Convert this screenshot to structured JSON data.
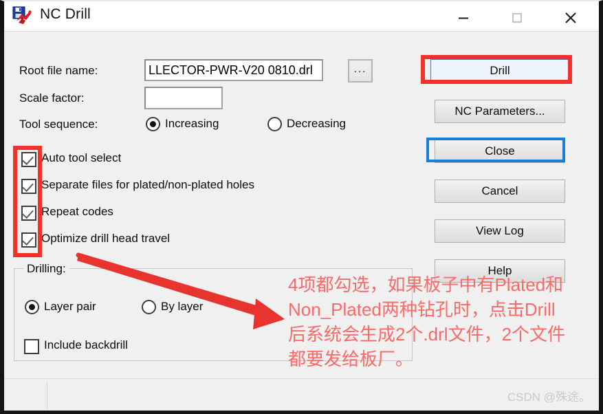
{
  "window": {
    "title": "NC Drill",
    "icon": "nc-drill-app-icon",
    "controls": {
      "minimize": "—",
      "maximize": "□",
      "close": "✕"
    }
  },
  "form": {
    "root_file_label": "Root file name:",
    "root_file_value": "LLECTOR-PWR-V20 0810.drl",
    "browse_label": "...",
    "scale_factor_label": "Scale factor:",
    "scale_factor_value": "",
    "tool_sequence_label": "Tool sequence:",
    "tool_sequence_options": [
      {
        "label": "Increasing",
        "selected": true
      },
      {
        "label": "Decreasing",
        "selected": false
      }
    ]
  },
  "options": [
    {
      "label": "Auto tool select",
      "checked": true
    },
    {
      "label": "Separate files for plated/non-plated holes",
      "checked": true
    },
    {
      "label": "Repeat codes",
      "checked": true
    },
    {
      "label": "Optimize drill head travel",
      "checked": true
    }
  ],
  "drilling": {
    "group_title": "Drilling:",
    "mode_options": [
      {
        "label": "Layer pair",
        "selected": true
      },
      {
        "label": "By layer",
        "selected": false
      }
    ],
    "include_backdrill": {
      "label": "Include backdrill",
      "checked": false
    }
  },
  "buttons": [
    {
      "label": "Drill",
      "style": "default",
      "highlight": "red"
    },
    {
      "label": "NC Parameters...",
      "style": "normal",
      "highlight": "none"
    },
    {
      "label": "Close",
      "style": "normal",
      "highlight": "blue"
    },
    {
      "label": "Cancel",
      "style": "normal",
      "highlight": "none"
    },
    {
      "label": "View Log",
      "style": "normal",
      "highlight": "none"
    },
    {
      "label": "Help",
      "style": "normal",
      "highlight": "none"
    }
  ],
  "annotation": {
    "line1": "4项都勾选，如果板子中有Plated和",
    "line2": "Non_Plated两种钻孔时，点击Drill",
    "line3": "后系统会生成2个.drl文件，2个文件",
    "line4": "都要发给板厂。",
    "color": "#fa6a66",
    "box_color": "#f3302c"
  },
  "watermark": {
    "text": "CSDN @殊途。"
  }
}
